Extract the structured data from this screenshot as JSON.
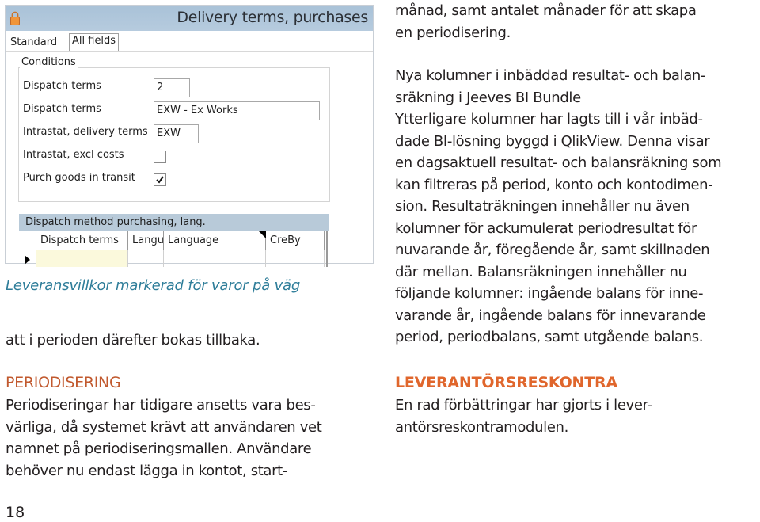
{
  "screenshot": {
    "window_title": "Delivery terms, purchases",
    "lock_icon": "lock-icon",
    "tabs": [
      {
        "label": "Standard",
        "active": true
      },
      {
        "label": "All fields",
        "active": false
      }
    ],
    "conditions": {
      "legend": "Conditions",
      "fields": [
        {
          "label": "Dispatch terms",
          "type": "text",
          "value": "2"
        },
        {
          "label": "Dispatch terms",
          "type": "text",
          "value": "EXW - Ex Works"
        },
        {
          "label": "Intrastat, delivery terms",
          "type": "text",
          "value": "EXW"
        },
        {
          "label": "Intrastat, excl costs",
          "type": "checkbox",
          "checked": false
        },
        {
          "label": "Purch goods in transit",
          "type": "checkbox",
          "checked": true
        }
      ]
    },
    "grid": {
      "title": "Dispatch method purchasing, lang.",
      "columns": [
        "Dispatch terms",
        "Langu",
        "Language",
        "CreBy"
      ],
      "current_row_marker": "row-pointer-icon"
    }
  },
  "caption": "Leveransvillkor markerad för varor på väg",
  "left_column": {
    "intro": "att i perioden därefter bokas tillbaka.",
    "section_heading": "PERIODISERING",
    "section_body": "Periodiseringar har tidigare ansetts vara bes-\nvärliga, då systemet krävt att användaren vet\nnamnet på periodiseringsmallen. Användare\nbehöver nu endast lägga in kontot, start-"
  },
  "right_column": {
    "continuation": "månad, samt antalet månader för att skapa\nen periodisering.",
    "subheading": "Nya kolumner i inbäddad resultat- och balan-\nsräkning i Jeeves BI Bundle",
    "paragraph": "Ytterligare kolumner har lagts till i vår inbäd-\ndade BI-lösning byggd i QlikView. Denna visar\nen dagsaktuell resultat- och balansräkning som\nkan filtreras på period, konto och kontodimen-\nsion. Resultaträkningen innehåller nu även\nkolumner för ackumulerat periodresultat för\nnuvarande år, föregående år, samt skillnaden\ndär mellan. Balansräkningen innehåller nu\nföljande kolumner: ingående balans för inne-\nvarande år, ingående balans för innevarande\nperiod, periodbalans, samt utgående balans.",
    "section_heading": "LEVERANTÖRSRESKONTRA",
    "section_body": "En rad förbättringar har gjorts i lever-\nantörsreskontramodulen."
  },
  "page_number": "18",
  "colors": {
    "caption": "#2e7d99",
    "heading_light": "#c1592e",
    "heading_bold": "#e0662c",
    "titlebar": "#b0c6da",
    "grid_header": "#b8cad9",
    "grid_selected_cell": "#fbf9dc"
  }
}
